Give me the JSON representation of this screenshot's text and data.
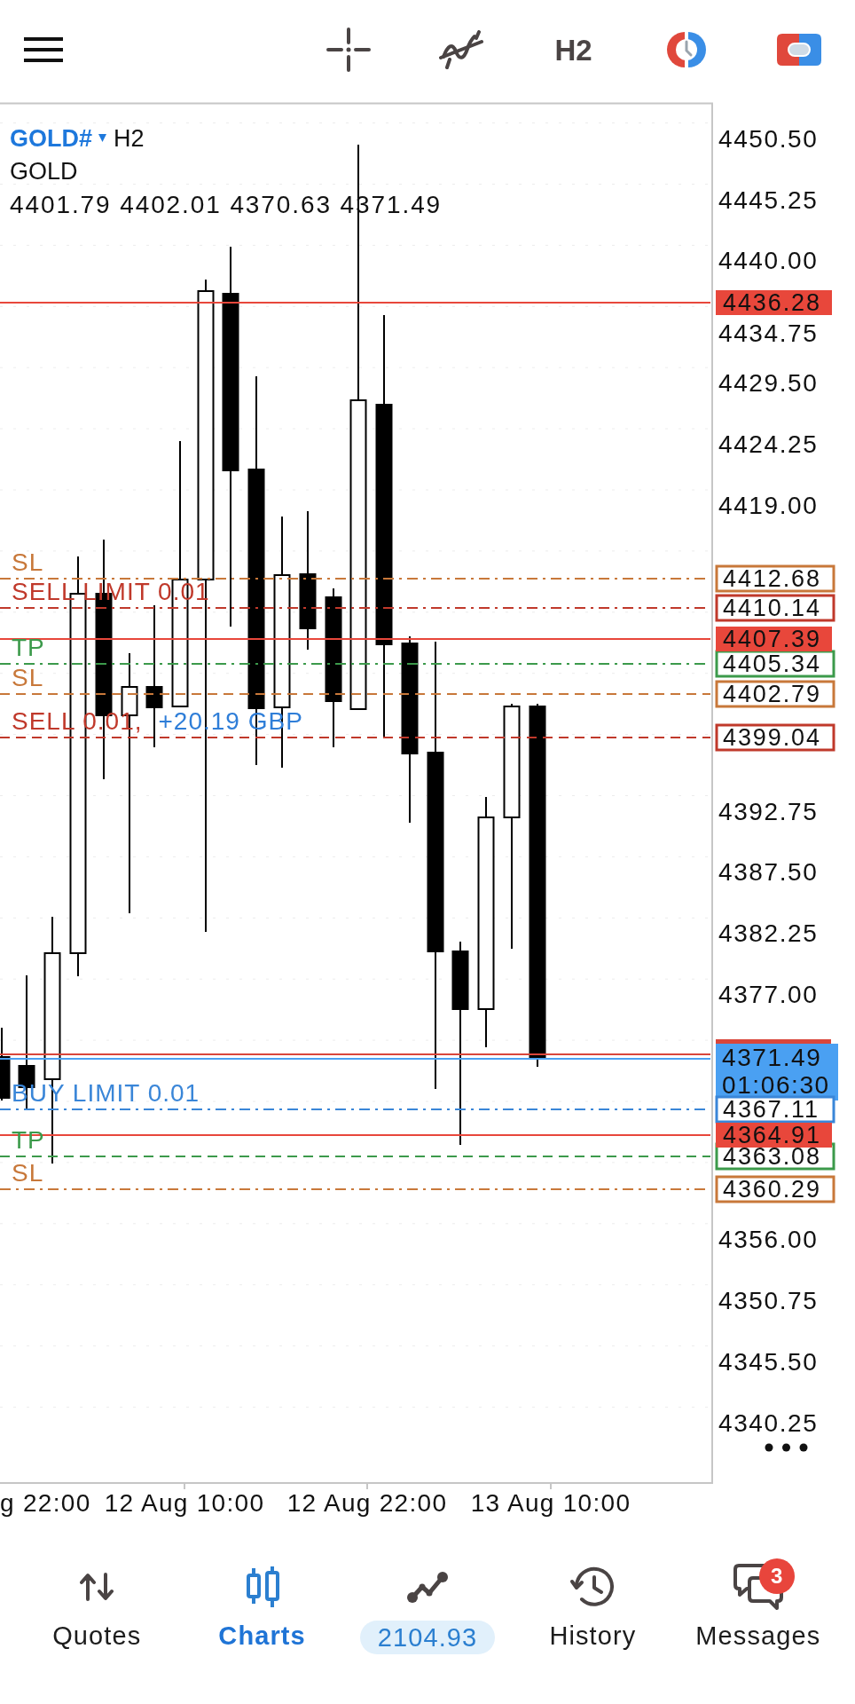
{
  "toolbar": {
    "timeframe": "H2"
  },
  "chart": {
    "symbol": "GOLD#",
    "timeframe": "H2",
    "description": "GOLD",
    "ohlc": "4401.79 4402.01 4370.63 4371.49",
    "price_axis": [
      "4450.50",
      "4445.25",
      "4440.00",
      "4434.75",
      "4429.50",
      "4424.25",
      "4419.00",
      "4392.75",
      "4387.50",
      "4382.25",
      "4377.00",
      "4356.00",
      "4350.75",
      "4345.50",
      "4340.25"
    ],
    "time_axis": [
      "g 22:00",
      "12 Aug 10:00",
      "12 Aug 22:00",
      "13 Aug 10:00"
    ],
    "levels": [
      {
        "kind": "solid",
        "color": "#e8473b",
        "tag": "4436.28"
      },
      {
        "kind": "dash_dot",
        "color": "#c8783a",
        "label": "SL",
        "tag": "4412.68"
      },
      {
        "kind": "dash_dot",
        "color": "#c0392b",
        "label": "SELL LIMIT 0.01",
        "tag": "4410.14"
      },
      {
        "kind": "solid",
        "color": "#e8473b",
        "tag": "4407.39"
      },
      {
        "kind": "dash_dot",
        "color": "#3c9a4b",
        "label": "TP",
        "tag": "4405.34"
      },
      {
        "kind": "dashed",
        "color": "#c8783a",
        "label": "SL",
        "tag": "4402.79"
      },
      {
        "kind": "dashed",
        "color": "#c0392b",
        "label": "SELL 0.01,",
        "profit": "+20.19 GBP",
        "tag": "4399.04"
      },
      {
        "kind": "ask",
        "color": "#d9463b"
      },
      {
        "kind": "bid",
        "color": "#4aa0f2",
        "tag": "4371.49",
        "countdown": "01:06:30"
      },
      {
        "kind": "dash_dot",
        "color": "#3a86d8",
        "label": "BUY LIMIT 0.01",
        "tag": "4367.11"
      },
      {
        "kind": "solid",
        "color": "#e8473b",
        "tag": "4364.91"
      },
      {
        "kind": "dashed",
        "color": "#3c9a4b",
        "label": "TP",
        "tag": "4363.08"
      },
      {
        "kind": "dash_dot",
        "color": "#c8783a",
        "label": "SL",
        "tag": "4360.29"
      }
    ]
  },
  "nav": [
    {
      "kind": "quotes",
      "label": "Quotes",
      "selected": false
    },
    {
      "kind": "charts",
      "label": "Charts",
      "selected": true
    },
    {
      "kind": "trade",
      "value": "2104.93",
      "selected": false
    },
    {
      "kind": "history",
      "label": "History",
      "selected": false
    },
    {
      "kind": "messages",
      "label": "Messages",
      "badge": "3",
      "selected": false
    }
  ]
}
